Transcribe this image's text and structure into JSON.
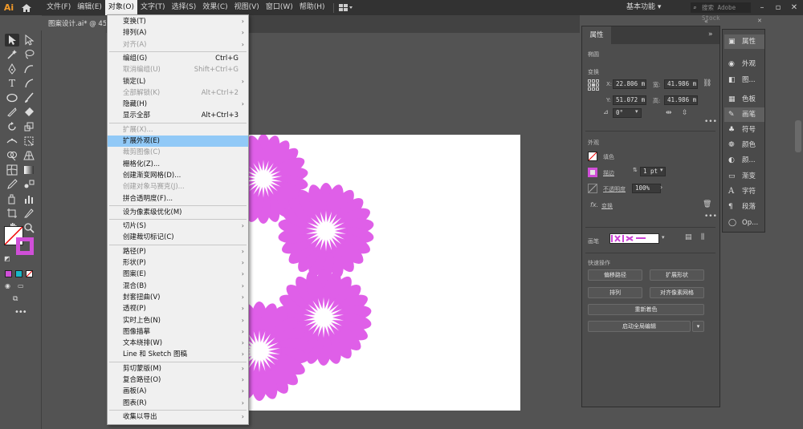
{
  "app": {
    "logo": "Ai"
  },
  "menubar": {
    "items": [
      "文件(F)",
      "编辑(E)",
      "对象(O)",
      "文字(T)",
      "选择(S)",
      "效果(C)",
      "视图(V)",
      "窗口(W)",
      "帮助(H)"
    ],
    "workspace": "基本功能",
    "stock_placeholder": "搜索 Adobe Stock"
  },
  "document": {
    "tab_title": "图案设计.ai* @ 45..."
  },
  "object_menu": {
    "items": [
      {
        "label": "变换(T)",
        "submenu": true
      },
      {
        "label": "排列(A)",
        "submenu": true
      },
      {
        "label": "对齐(A)",
        "submenu": true,
        "disabled": true
      },
      {
        "label": "编组(G)",
        "shortcut": "Ctrl+G"
      },
      {
        "label": "取消编组(U)",
        "shortcut": "Shift+Ctrl+G",
        "disabled": true
      },
      {
        "label": "锁定(L)",
        "submenu": true
      },
      {
        "label": "全部解锁(K)",
        "shortcut": "Alt+Ctrl+2",
        "disabled": true
      },
      {
        "label": "隐藏(H)",
        "submenu": true
      },
      {
        "label": "显示全部",
        "shortcut": "Alt+Ctrl+3"
      },
      {
        "label": "扩展(X)...",
        "disabled": true
      },
      {
        "label": "扩展外观(E)",
        "highlighted": true
      },
      {
        "label": "裁剪图像(C)",
        "disabled": true
      },
      {
        "label": "栅格化(Z)..."
      },
      {
        "label": "创建渐变网格(D)..."
      },
      {
        "label": "创建对象马赛克(J)...",
        "disabled": true
      },
      {
        "label": "拼合透明度(F)..."
      },
      {
        "label": "设为像素级优化(M)"
      },
      {
        "label": "切片(S)",
        "submenu": true
      },
      {
        "label": "创建裁切标记(C)"
      },
      {
        "label": "路径(P)",
        "submenu": true
      },
      {
        "label": "形状(P)",
        "submenu": true
      },
      {
        "label": "图案(E)",
        "submenu": true
      },
      {
        "label": "混合(B)",
        "submenu": true
      },
      {
        "label": "封套扭曲(V)",
        "submenu": true
      },
      {
        "label": "透视(P)",
        "submenu": true
      },
      {
        "label": "实时上色(N)",
        "submenu": true
      },
      {
        "label": "图像描摹",
        "submenu": true
      },
      {
        "label": "文本绕排(W)",
        "submenu": true
      },
      {
        "label": "Line 和 Sketch 图稿",
        "submenu": true
      },
      {
        "label": "剪切蒙版(M)",
        "submenu": true
      },
      {
        "label": "复合路径(O)",
        "submenu": true
      },
      {
        "label": "画板(A)",
        "submenu": true
      },
      {
        "label": "图表(R)",
        "submenu": true
      },
      {
        "label": "收集以导出",
        "submenu": true
      }
    ]
  },
  "properties": {
    "tab": "属性",
    "object_type": "椭圆",
    "transform_label": "变换",
    "x_label": "X:",
    "x": "22.806 m",
    "y_label": "Y:",
    "y": "51.072 m",
    "w_label": "宽:",
    "w": "41.986 m",
    "h_label": "高:",
    "h": "41.986 m",
    "angle": "0°",
    "appearance_label": "外观",
    "fill_label": "填色",
    "stroke_label": "描边",
    "stroke_value": "1 pt",
    "opacity_label": "不透明度",
    "opacity_value": "100%",
    "fx_label": "fx.",
    "fx_item": "变换",
    "brush_label": "画笔",
    "quick_actions_label": "快速操作",
    "buttons": [
      "偏移路径",
      "扩展形状",
      "排列",
      "对齐像素网格",
      "重新着色",
      "启动全局编辑"
    ]
  },
  "dock": {
    "items": [
      "属性",
      "外观",
      "图...",
      "色板",
      "画笔",
      "符号",
      "颜色",
      "颜...",
      "渐变",
      "字符",
      "段落",
      "Op..."
    ]
  },
  "colors": {
    "flower": "#df5fe8",
    "menu_highlight": "#91c9f7",
    "stroke_swatch": "#d04fd8"
  }
}
